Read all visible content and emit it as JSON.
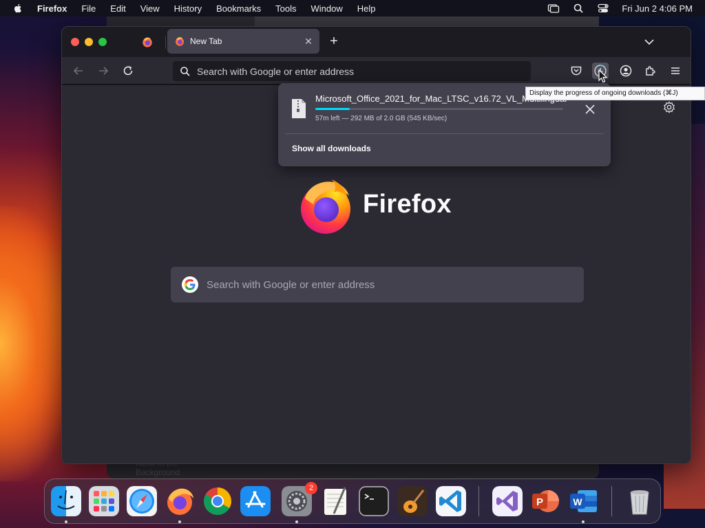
{
  "menubar": {
    "app_name": "Firefox",
    "menus": [
      "File",
      "Edit",
      "View",
      "History",
      "Bookmarks",
      "Tools",
      "Window",
      "Help"
    ],
    "clock": "Fri Jun 2  4:06 PM"
  },
  "background": {
    "window_text": "Allow in the Background"
  },
  "browser": {
    "active_tab_title": "New Tab",
    "urlbar_placeholder": "Search with Google or enter address",
    "wordmark": "Firefox",
    "page_search_placeholder": "Search with Google or enter address"
  },
  "downloads": {
    "file_name": "Microsoft_Office_2021_for_Mac_LTSC_v16.72_VL_Multilingual",
    "status": "57m left — 292 MB of 2.0 GB (545 KB/sec)",
    "progress_fraction": 0.14,
    "show_all_label": "Show all downloads",
    "tooltip": "Display the progress of ongoing downloads (⌘J)"
  },
  "dock": {
    "apps": [
      {
        "name": "Finder",
        "running": true
      },
      {
        "name": "Launchpad",
        "running": false
      },
      {
        "name": "Safari",
        "running": false
      },
      {
        "name": "Firefox",
        "running": true
      },
      {
        "name": "Google Chrome",
        "running": false
      },
      {
        "name": "App Store",
        "running": false
      },
      {
        "name": "System Settings",
        "running": true,
        "badge": "2"
      },
      {
        "name": "TextEdit",
        "running": false
      },
      {
        "name": "Terminal",
        "running": false
      },
      {
        "name": "GarageBand",
        "running": false
      },
      {
        "name": "Visual Studio Code",
        "running": false
      },
      {
        "name": "Visual Studio",
        "running": false
      },
      {
        "name": "Microsoft PowerPoint",
        "running": false
      },
      {
        "name": "Microsoft Word",
        "running": true
      },
      {
        "name": "Trash",
        "running": false
      }
    ]
  },
  "colors": {
    "accent_progress": "#00ddff",
    "panel_bg": "#42414d",
    "page_bg": "#2b2a33"
  }
}
